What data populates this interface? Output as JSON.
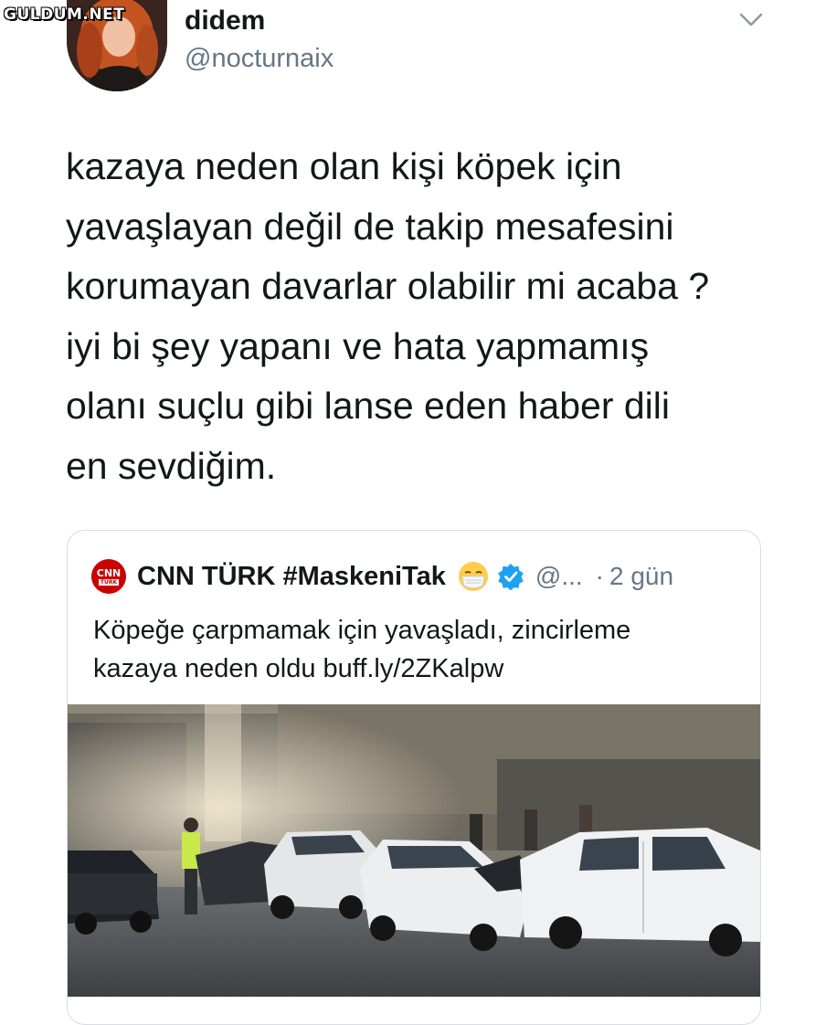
{
  "watermark": "GULDUM.NET",
  "tweet": {
    "author": {
      "display_name": "didem",
      "handle": "@nocturnaix"
    },
    "text_lines": [
      "kazaya neden olan kişi köpek için",
      "yavaşlayan değil de takip mesafesini",
      "korumayan davarlar olabilir mi acaba ?",
      "iyi bi şey yapanı ve hata yapmamış",
      "olanı suçlu gibi lanse eden haber dili",
      "en sevdiğim."
    ]
  },
  "quoted_tweet": {
    "logo_text_top": "CNN",
    "logo_text_bottom": "TÜRK",
    "display_name": "CNN TÜRK #MaskeniTak",
    "handle": "@...",
    "separator": "·",
    "time": "2 gün",
    "text_lines": [
      "Köpeğe çarpmamak için yavaşladı, zincirleme",
      "kazaya neden oldu buff.ly/2ZKalpw"
    ],
    "media_description_icon": "car-crash-photo"
  },
  "colors": {
    "text_primary": "#14171a",
    "text_secondary": "#657786",
    "border": "#d6dde3",
    "verified": "#1da1f2",
    "cnn_red": "#cc0000"
  }
}
